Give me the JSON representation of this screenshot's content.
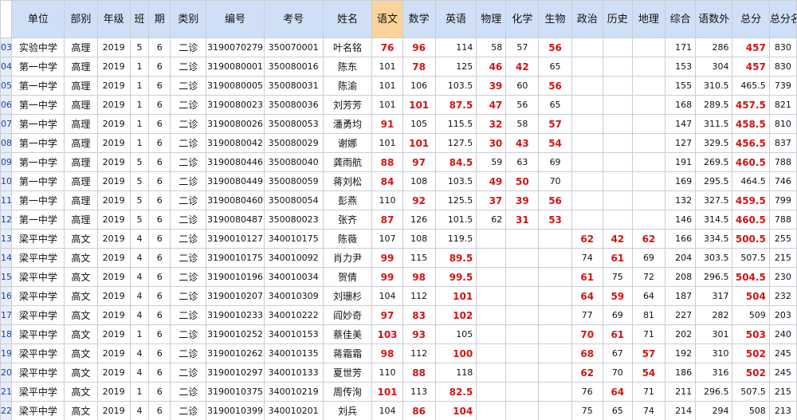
{
  "headers": [
    "单位",
    "部别",
    "年级",
    "班",
    "期",
    "类别",
    "编号",
    "考号",
    "姓名",
    "语文",
    "数学",
    "英语",
    "物理",
    "化学",
    "生物",
    "政治",
    "历史",
    "地理",
    "综合",
    "语数外",
    "总分",
    "总分名次"
  ],
  "rows": [
    {
      "rn": "03",
      "c": [
        "实验中学",
        "高理",
        "2019",
        "5",
        "6",
        "二诊",
        "3190070279",
        "350070001",
        "叶名铭",
        "76",
        "96",
        "114",
        "58",
        "57",
        "56",
        "",
        "",
        "",
        "171",
        "286",
        "457",
        "830"
      ],
      "red": [
        9,
        10,
        14,
        20
      ]
    },
    {
      "rn": "04",
      "c": [
        "第一中学",
        "高理",
        "2019",
        "1",
        "6",
        "二诊",
        "3190080001",
        "350080016",
        "陈东",
        "101",
        "78",
        "125",
        "46",
        "42",
        "65",
        "",
        "",
        "",
        "153",
        "304",
        "457",
        "830"
      ],
      "red": [
        10,
        12,
        13,
        20
      ]
    },
    {
      "rn": "05",
      "c": [
        "第一中学",
        "高理",
        "2019",
        "1",
        "6",
        "二诊",
        "3190080005",
        "350080031",
        "陈渝",
        "101",
        "106",
        "103.5",
        "39",
        "60",
        "56",
        "",
        "",
        "",
        "155",
        "310.5",
        "465.5",
        "739"
      ],
      "red": [
        12,
        14
      ]
    },
    {
      "rn": "06",
      "c": [
        "第一中学",
        "高理",
        "2019",
        "1",
        "6",
        "二诊",
        "3190080023",
        "350080036",
        "刘芳芳",
        "101",
        "101",
        "87.5",
        "47",
        "56",
        "65",
        "",
        "",
        "",
        "168",
        "289.5",
        "457.5",
        "821"
      ],
      "red": [
        10,
        11,
        12,
        20
      ]
    },
    {
      "rn": "07",
      "c": [
        "第一中学",
        "高理",
        "2019",
        "1",
        "6",
        "二诊",
        "3190080026",
        "350080053",
        "潘勇均",
        "91",
        "105",
        "115.5",
        "32",
        "58",
        "57",
        "",
        "",
        "",
        "147",
        "311.5",
        "458.5",
        "810"
      ],
      "red": [
        9,
        12,
        14,
        20
      ]
    },
    {
      "rn": "08",
      "c": [
        "第一中学",
        "高理",
        "2019",
        "1",
        "6",
        "二诊",
        "3190080042",
        "350080029",
        "谢娜",
        "101",
        "101",
        "127.5",
        "30",
        "43",
        "54",
        "",
        "",
        "",
        "127",
        "329.5",
        "456.5",
        "837"
      ],
      "red": [
        10,
        12,
        13,
        14,
        20
      ]
    },
    {
      "rn": "09",
      "c": [
        "第一中学",
        "高理",
        "2019",
        "5",
        "6",
        "二诊",
        "3190080446",
        "350080040",
        "龚雨航",
        "88",
        "97",
        "84.5",
        "59",
        "63",
        "69",
        "",
        "",
        "",
        "191",
        "269.5",
        "460.5",
        "788"
      ],
      "red": [
        9,
        10,
        11,
        20
      ]
    },
    {
      "rn": "10",
      "c": [
        "第一中学",
        "高理",
        "2019",
        "5",
        "6",
        "二诊",
        "3190080449",
        "350080059",
        "蒋刘松",
        "84",
        "108",
        "103.5",
        "49",
        "50",
        "70",
        "",
        "",
        "",
        "169",
        "295.5",
        "464.5",
        "746"
      ],
      "red": [
        9,
        12,
        13
      ]
    },
    {
      "rn": "11",
      "c": [
        "第一中学",
        "高理",
        "2019",
        "5",
        "6",
        "二诊",
        "3190080460",
        "350080054",
        "彭燕",
        "110",
        "92",
        "125.5",
        "37",
        "39",
        "56",
        "",
        "",
        "",
        "132",
        "327.5",
        "459.5",
        "799"
      ],
      "red": [
        10,
        12,
        13,
        14,
        20
      ]
    },
    {
      "rn": "12",
      "c": [
        "第一中学",
        "高理",
        "2019",
        "5",
        "6",
        "二诊",
        "3190080487",
        "350080023",
        "张齐",
        "87",
        "126",
        "101.5",
        "62",
        "31",
        "53",
        "",
        "",
        "",
        "146",
        "314.5",
        "460.5",
        "788"
      ],
      "red": [
        9,
        13,
        14,
        20
      ]
    },
    {
      "rn": "13",
      "c": [
        "梁平中学",
        "高文",
        "2019",
        "4",
        "6",
        "二诊",
        "3190010127",
        "340010175",
        "陈薇",
        "107",
        "108",
        "119.5",
        "",
        "",
        "",
        "62",
        "42",
        "62",
        "166",
        "334.5",
        "500.5",
        "255"
      ],
      "red": [
        15,
        16,
        17,
        20
      ]
    },
    {
      "rn": "14",
      "c": [
        "梁平中学",
        "高文",
        "2019",
        "4",
        "6",
        "二诊",
        "3190010175",
        "340010092",
        "肖力尹",
        "99",
        "115",
        "89.5",
        "",
        "",
        "",
        "74",
        "61",
        "69",
        "204",
        "303.5",
        "507.5",
        "215"
      ],
      "red": [
        9,
        11,
        16
      ]
    },
    {
      "rn": "15",
      "c": [
        "梁平中学",
        "高文",
        "2019",
        "4",
        "6",
        "二诊",
        "3190010196",
        "340010034",
        "贺倩",
        "99",
        "98",
        "99.5",
        "",
        "",
        "",
        "61",
        "75",
        "72",
        "208",
        "296.5",
        "504.5",
        "230"
      ],
      "red": [
        9,
        10,
        11,
        15,
        20
      ]
    },
    {
      "rn": "16",
      "c": [
        "梁平中学",
        "高文",
        "2019",
        "4",
        "6",
        "二诊",
        "3190010207",
        "340010309",
        "刘珊杉",
        "104",
        "112",
        "101",
        "",
        "",
        "",
        "64",
        "59",
        "64",
        "187",
        "317",
        "504",
        "232"
      ],
      "red": [
        11,
        15,
        16,
        20
      ]
    },
    {
      "rn": "17",
      "c": [
        "梁平中学",
        "高文",
        "2019",
        "4",
        "6",
        "二诊",
        "3190010233",
        "340010222",
        "阎妙奇",
        "97",
        "83",
        "102",
        "",
        "",
        "",
        "77",
        "69",
        "81",
        "227",
        "282",
        "509",
        "203"
      ],
      "red": [
        9,
        10,
        11
      ]
    },
    {
      "rn": "18",
      "c": [
        "梁平中学",
        "高文",
        "2019",
        "1",
        "6",
        "二诊",
        "3190010252",
        "340010153",
        "蔡佳美",
        "103",
        "93",
        "105",
        "",
        "",
        "",
        "70",
        "61",
        "71",
        "202",
        "301",
        "503",
        "240"
      ],
      "red": [
        9,
        10,
        15,
        16,
        20
      ]
    },
    {
      "rn": "19",
      "c": [
        "梁平中学",
        "高文",
        "2019",
        "4",
        "6",
        "二诊",
        "3190010262",
        "340010135",
        "蒋霜霜",
        "98",
        "112",
        "100",
        "",
        "",
        "",
        "68",
        "67",
        "57",
        "192",
        "310",
        "502",
        "245"
      ],
      "red": [
        9,
        11,
        15,
        17,
        20
      ]
    },
    {
      "rn": "20",
      "c": [
        "梁平中学",
        "高文",
        "2019",
        "4",
        "6",
        "二诊",
        "3190010297",
        "340010133",
        "夏世芳",
        "110",
        "88",
        "118",
        "",
        "",
        "",
        "62",
        "70",
        "54",
        "186",
        "316",
        "502",
        "245"
      ],
      "red": [
        10,
        15,
        17,
        20
      ]
    },
    {
      "rn": "21",
      "c": [
        "梁平中学",
        "高文",
        "2019",
        "1",
        "6",
        "二诊",
        "3190010375",
        "340010219",
        "周传洵",
        "101",
        "113",
        "82.5",
        "",
        "",
        "",
        "76",
        "64",
        "71",
        "211",
        "296.5",
        "507.5",
        "215"
      ],
      "red": [
        9,
        11,
        16
      ]
    },
    {
      "rn": "22",
      "c": [
        "梁平中学",
        "高文",
        "2019",
        "4",
        "6",
        "二诊",
        "3190010399",
        "340010201",
        "刘兵",
        "104",
        "86",
        "104",
        "",
        "",
        "",
        "75",
        "65",
        "74",
        "214",
        "294",
        "508",
        "213"
      ],
      "red": [
        10,
        11
      ]
    }
  ]
}
